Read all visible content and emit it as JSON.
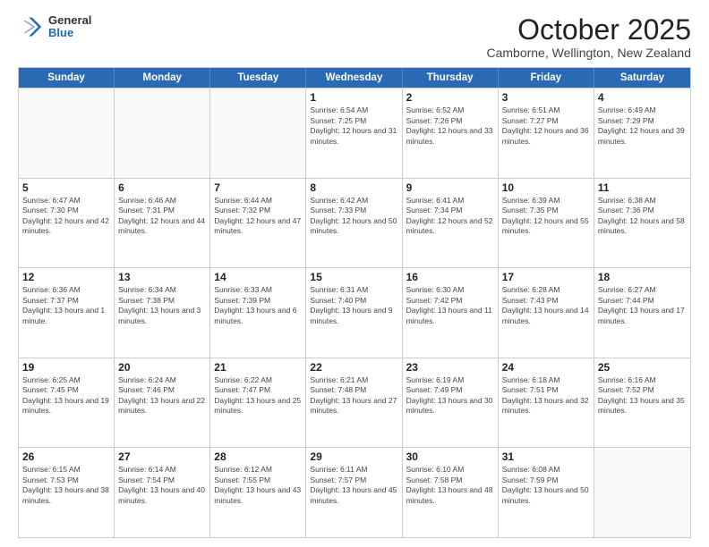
{
  "header": {
    "logo": {
      "general": "General",
      "blue": "Blue"
    },
    "title": "October 2025",
    "location": "Camborne, Wellington, New Zealand"
  },
  "weekdays": [
    "Sunday",
    "Monday",
    "Tuesday",
    "Wednesday",
    "Thursday",
    "Friday",
    "Saturday"
  ],
  "rows": [
    [
      {
        "day": "",
        "info": ""
      },
      {
        "day": "",
        "info": ""
      },
      {
        "day": "",
        "info": ""
      },
      {
        "day": "1",
        "info": "Sunrise: 6:54 AM\nSunset: 7:25 PM\nDaylight: 12 hours and 31 minutes."
      },
      {
        "day": "2",
        "info": "Sunrise: 6:52 AM\nSunset: 7:26 PM\nDaylight: 12 hours and 33 minutes."
      },
      {
        "day": "3",
        "info": "Sunrise: 6:51 AM\nSunset: 7:27 PM\nDaylight: 12 hours and 36 minutes."
      },
      {
        "day": "4",
        "info": "Sunrise: 6:49 AM\nSunset: 7:29 PM\nDaylight: 12 hours and 39 minutes."
      }
    ],
    [
      {
        "day": "5",
        "info": "Sunrise: 6:47 AM\nSunset: 7:30 PM\nDaylight: 12 hours and 42 minutes."
      },
      {
        "day": "6",
        "info": "Sunrise: 6:46 AM\nSunset: 7:31 PM\nDaylight: 12 hours and 44 minutes."
      },
      {
        "day": "7",
        "info": "Sunrise: 6:44 AM\nSunset: 7:32 PM\nDaylight: 12 hours and 47 minutes."
      },
      {
        "day": "8",
        "info": "Sunrise: 6:42 AM\nSunset: 7:33 PM\nDaylight: 12 hours and 50 minutes."
      },
      {
        "day": "9",
        "info": "Sunrise: 6:41 AM\nSunset: 7:34 PM\nDaylight: 12 hours and 52 minutes."
      },
      {
        "day": "10",
        "info": "Sunrise: 6:39 AM\nSunset: 7:35 PM\nDaylight: 12 hours and 55 minutes."
      },
      {
        "day": "11",
        "info": "Sunrise: 6:38 AM\nSunset: 7:36 PM\nDaylight: 12 hours and 58 minutes."
      }
    ],
    [
      {
        "day": "12",
        "info": "Sunrise: 6:36 AM\nSunset: 7:37 PM\nDaylight: 13 hours and 1 minute."
      },
      {
        "day": "13",
        "info": "Sunrise: 6:34 AM\nSunset: 7:38 PM\nDaylight: 13 hours and 3 minutes."
      },
      {
        "day": "14",
        "info": "Sunrise: 6:33 AM\nSunset: 7:39 PM\nDaylight: 13 hours and 6 minutes."
      },
      {
        "day": "15",
        "info": "Sunrise: 6:31 AM\nSunset: 7:40 PM\nDaylight: 13 hours and 9 minutes."
      },
      {
        "day": "16",
        "info": "Sunrise: 6:30 AM\nSunset: 7:42 PM\nDaylight: 13 hours and 11 minutes."
      },
      {
        "day": "17",
        "info": "Sunrise: 6:28 AM\nSunset: 7:43 PM\nDaylight: 13 hours and 14 minutes."
      },
      {
        "day": "18",
        "info": "Sunrise: 6:27 AM\nSunset: 7:44 PM\nDaylight: 13 hours and 17 minutes."
      }
    ],
    [
      {
        "day": "19",
        "info": "Sunrise: 6:25 AM\nSunset: 7:45 PM\nDaylight: 13 hours and 19 minutes."
      },
      {
        "day": "20",
        "info": "Sunrise: 6:24 AM\nSunset: 7:46 PM\nDaylight: 13 hours and 22 minutes."
      },
      {
        "day": "21",
        "info": "Sunrise: 6:22 AM\nSunset: 7:47 PM\nDaylight: 13 hours and 25 minutes."
      },
      {
        "day": "22",
        "info": "Sunrise: 6:21 AM\nSunset: 7:48 PM\nDaylight: 13 hours and 27 minutes."
      },
      {
        "day": "23",
        "info": "Sunrise: 6:19 AM\nSunset: 7:49 PM\nDaylight: 13 hours and 30 minutes."
      },
      {
        "day": "24",
        "info": "Sunrise: 6:18 AM\nSunset: 7:51 PM\nDaylight: 13 hours and 32 minutes."
      },
      {
        "day": "25",
        "info": "Sunrise: 6:16 AM\nSunset: 7:52 PM\nDaylight: 13 hours and 35 minutes."
      }
    ],
    [
      {
        "day": "26",
        "info": "Sunrise: 6:15 AM\nSunset: 7:53 PM\nDaylight: 13 hours and 38 minutes."
      },
      {
        "day": "27",
        "info": "Sunrise: 6:14 AM\nSunset: 7:54 PM\nDaylight: 13 hours and 40 minutes."
      },
      {
        "day": "28",
        "info": "Sunrise: 6:12 AM\nSunset: 7:55 PM\nDaylight: 13 hours and 43 minutes."
      },
      {
        "day": "29",
        "info": "Sunrise: 6:11 AM\nSunset: 7:57 PM\nDaylight: 13 hours and 45 minutes."
      },
      {
        "day": "30",
        "info": "Sunrise: 6:10 AM\nSunset: 7:58 PM\nDaylight: 13 hours and 48 minutes."
      },
      {
        "day": "31",
        "info": "Sunrise: 6:08 AM\nSunset: 7:59 PM\nDaylight: 13 hours and 50 minutes."
      },
      {
        "day": "",
        "info": ""
      }
    ]
  ]
}
